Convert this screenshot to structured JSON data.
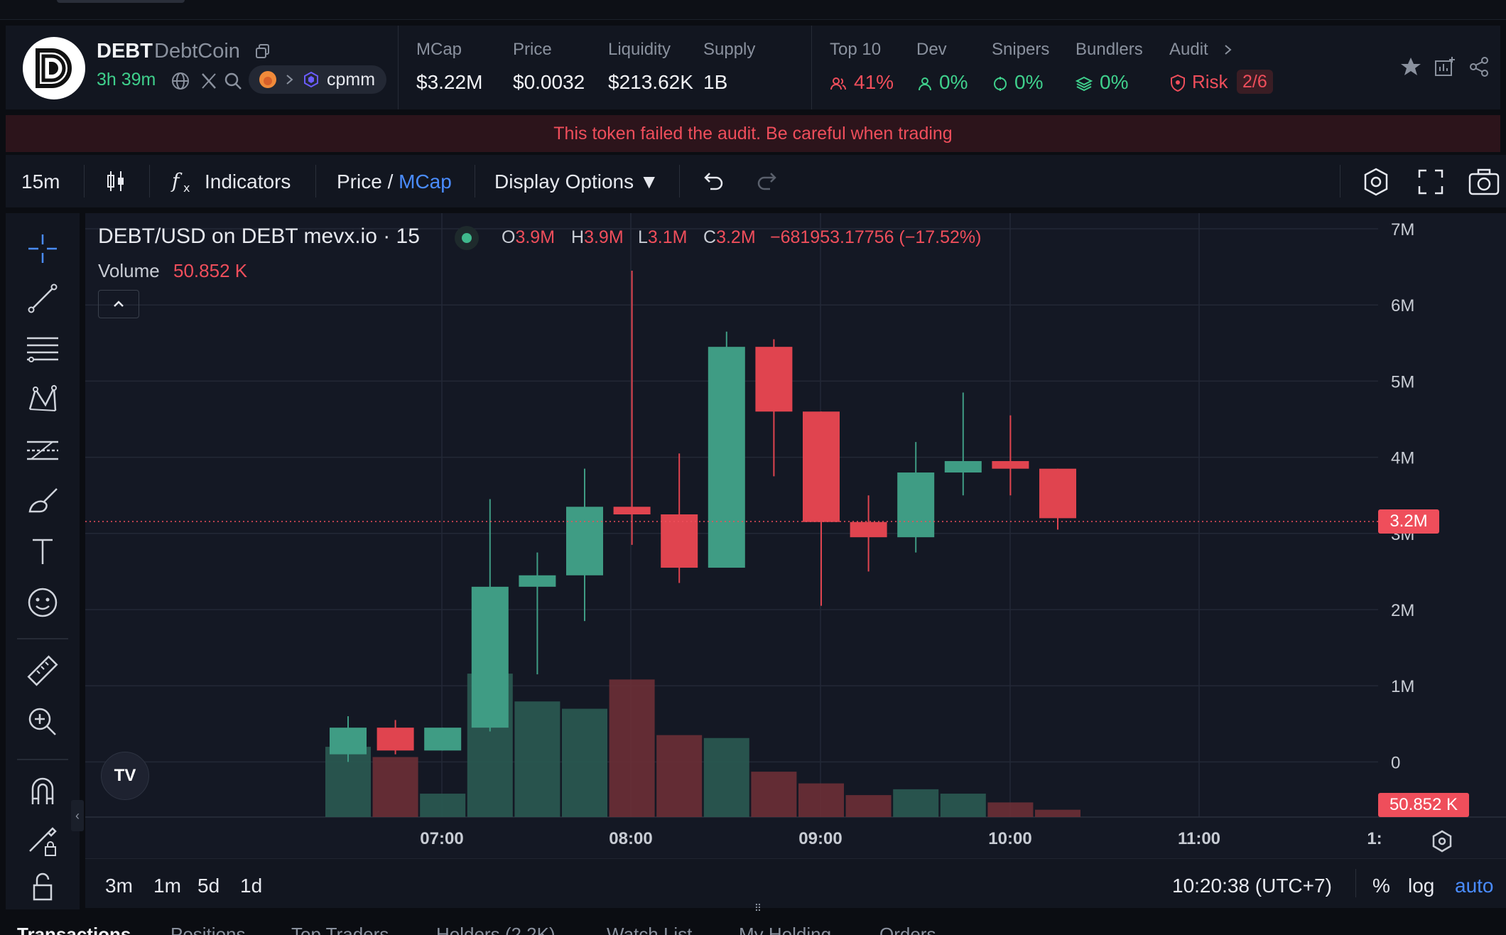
{
  "header": {
    "symbol": "DEBT",
    "name": "DebtCoin",
    "age": "3h 39m",
    "pool": "cpmm",
    "stats": [
      {
        "label": "MCap",
        "value": "$3.22M"
      },
      {
        "label": "Price",
        "value": "$0.0032"
      },
      {
        "label": "Liquidity",
        "value": "$213.62K"
      },
      {
        "label": "Supply",
        "value": "1B"
      }
    ],
    "holders": [
      {
        "label": "Top 10",
        "value": "41%"
      },
      {
        "label": "Dev",
        "value": "0%"
      },
      {
        "label": "Snipers",
        "value": "0%"
      },
      {
        "label": "Bundlers",
        "value": "0%"
      }
    ],
    "audit_label": "Audit",
    "risk_label": "Risk",
    "risk_value": "2/6"
  },
  "warning": "This token failed the audit. Be careful when trading",
  "toolbar": {
    "interval": "15m",
    "indicators": "Indicators",
    "price_label": "Price",
    "slash": "/",
    "mcap_label": "MCap",
    "display_options": "Display Options ▼"
  },
  "legend": {
    "title": "DEBT/USD on DEBT mevx.io · 15",
    "open_key": "O",
    "open": "3.9M",
    "high_key": "H",
    "high": "3.9M",
    "low_key": "L",
    "low": "3.1M",
    "close_key": "C",
    "close": "3.2M",
    "change": "−681953.17756 (−17.52%)",
    "volume_label": "Volume",
    "volume_value": "50.852 K"
  },
  "chart_data": {
    "type": "candlestick",
    "y_ticks": [
      "7M",
      "6M",
      "5M",
      "4M",
      "3M",
      "2M",
      "1M",
      "0"
    ],
    "ylim": [
      0,
      7000000
    ],
    "x_ticks": [
      "07:00",
      "08:00",
      "09:00",
      "10:00",
      "11:00",
      "1:"
    ],
    "current_price_label": "3.2M",
    "current_volume_label": "50.852 K",
    "candles": [
      {
        "open": 100000,
        "high": 600000,
        "low": 0,
        "close": 450000
      },
      {
        "open": 450000,
        "high": 550000,
        "low": 100000,
        "close": 150000
      },
      {
        "open": 150000,
        "high": 450000,
        "low": 150000,
        "close": 450000
      },
      {
        "open": 450000,
        "high": 3450000,
        "low": 400000,
        "close": 2300000
      },
      {
        "open": 2300000,
        "high": 2750000,
        "low": 1150000,
        "close": 2450000
      },
      {
        "open": 2450000,
        "high": 3850000,
        "low": 1850000,
        "close": 3350000
      },
      {
        "open": 3350000,
        "high": 6450000,
        "low": 2850000,
        "close": 3250000
      },
      {
        "open": 3250000,
        "high": 4050000,
        "low": 2350000,
        "close": 2550000
      },
      {
        "open": 2550000,
        "high": 5650000,
        "low": 2550000,
        "close": 5450000
      },
      {
        "open": 5450000,
        "high": 5550000,
        "low": 3750000,
        "close": 4600000
      },
      {
        "open": 4600000,
        "high": 4600000,
        "low": 2050000,
        "close": 3150000
      },
      {
        "open": 3150000,
        "high": 3500000,
        "low": 2500000,
        "close": 2950000
      },
      {
        "open": 2950000,
        "high": 4200000,
        "low": 2750000,
        "close": 3800000
      },
      {
        "open": 3800000,
        "high": 4850000,
        "low": 3500000,
        "close": 3950000
      },
      {
        "open": 3950000,
        "high": 4550000,
        "low": 3500000,
        "close": 3850000
      },
      {
        "open": 3850000,
        "high": 3850000,
        "low": 3050000,
        "close": 3200000
      }
    ],
    "volumes": [
      0.48,
      0.41,
      0.16,
      0.98,
      0.79,
      0.74,
      0.94,
      0.56,
      0.54,
      0.31,
      0.23,
      0.15,
      0.19,
      0.16,
      0.1,
      0.05
    ]
  },
  "bottombar": {
    "ranges": [
      "3m",
      "1m",
      "5d",
      "1d"
    ],
    "time": "10:20:38 (UTC+7)",
    "pct": "%",
    "log": "log",
    "auto": "auto"
  },
  "tabs": [
    "Transactions",
    "Positions",
    "Top Traders",
    "Holders (2.2K)",
    "Watch List",
    "My Holding",
    "Orders"
  ]
}
